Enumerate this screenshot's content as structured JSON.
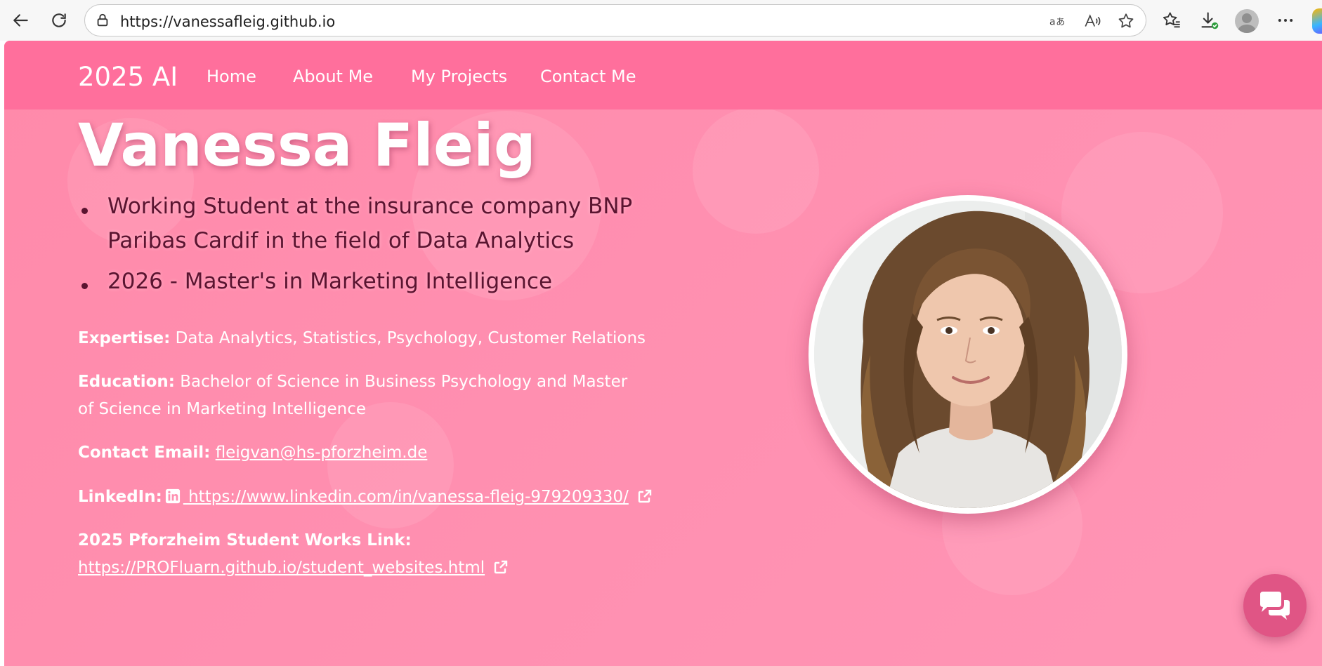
{
  "browser": {
    "url": "https://vanessafleig.github.io"
  },
  "site": {
    "brand": "2025 AI",
    "nav": [
      {
        "label": "Home"
      },
      {
        "label": "About Me"
      },
      {
        "label": "My Projects"
      },
      {
        "label": "Contact Me"
      }
    ]
  },
  "hero": {
    "name": "Vanessa Fleig",
    "bullets": [
      "Working Student at the insurance company BNP Paribas Cardif in the field of Data Analytics",
      "2026 - Master's in Marketing Intelligence"
    ],
    "expertise_label": "Expertise:",
    "expertise_value": "Data Analytics, Statistics, Psychology, Customer Relations",
    "education_label": "Education:",
    "education_value": "Bachelor of Science in Business Psychology and Master of Science in Marketing Intelligence",
    "email_label": "Contact Email:",
    "email_value": "fleigvan@hs-pforzheim.de",
    "linkedin_label": "LinkedIn:",
    "linkedin_value": " https://www.linkedin.com/in/vanessa-fleig-979209330/",
    "works_label": "2025 Pforzheim Student Works Link:",
    "works_value": "https://PROFluarn.github.io/student_websites.html"
  },
  "colors": {
    "nav_bg": "#ff6f9c",
    "page_bg": "#ff8fb0",
    "bullet_text": "#5a1430",
    "chat_button": "#e05585"
  },
  "icons": [
    "back-icon",
    "reload-icon",
    "lock-icon",
    "translate-icon",
    "read-aloud-icon",
    "favorite-star-icon",
    "favorites-icon",
    "downloads-icon",
    "profile-icon",
    "more-icon",
    "linkedin-icon",
    "external-link-icon",
    "chat-icon"
  ]
}
